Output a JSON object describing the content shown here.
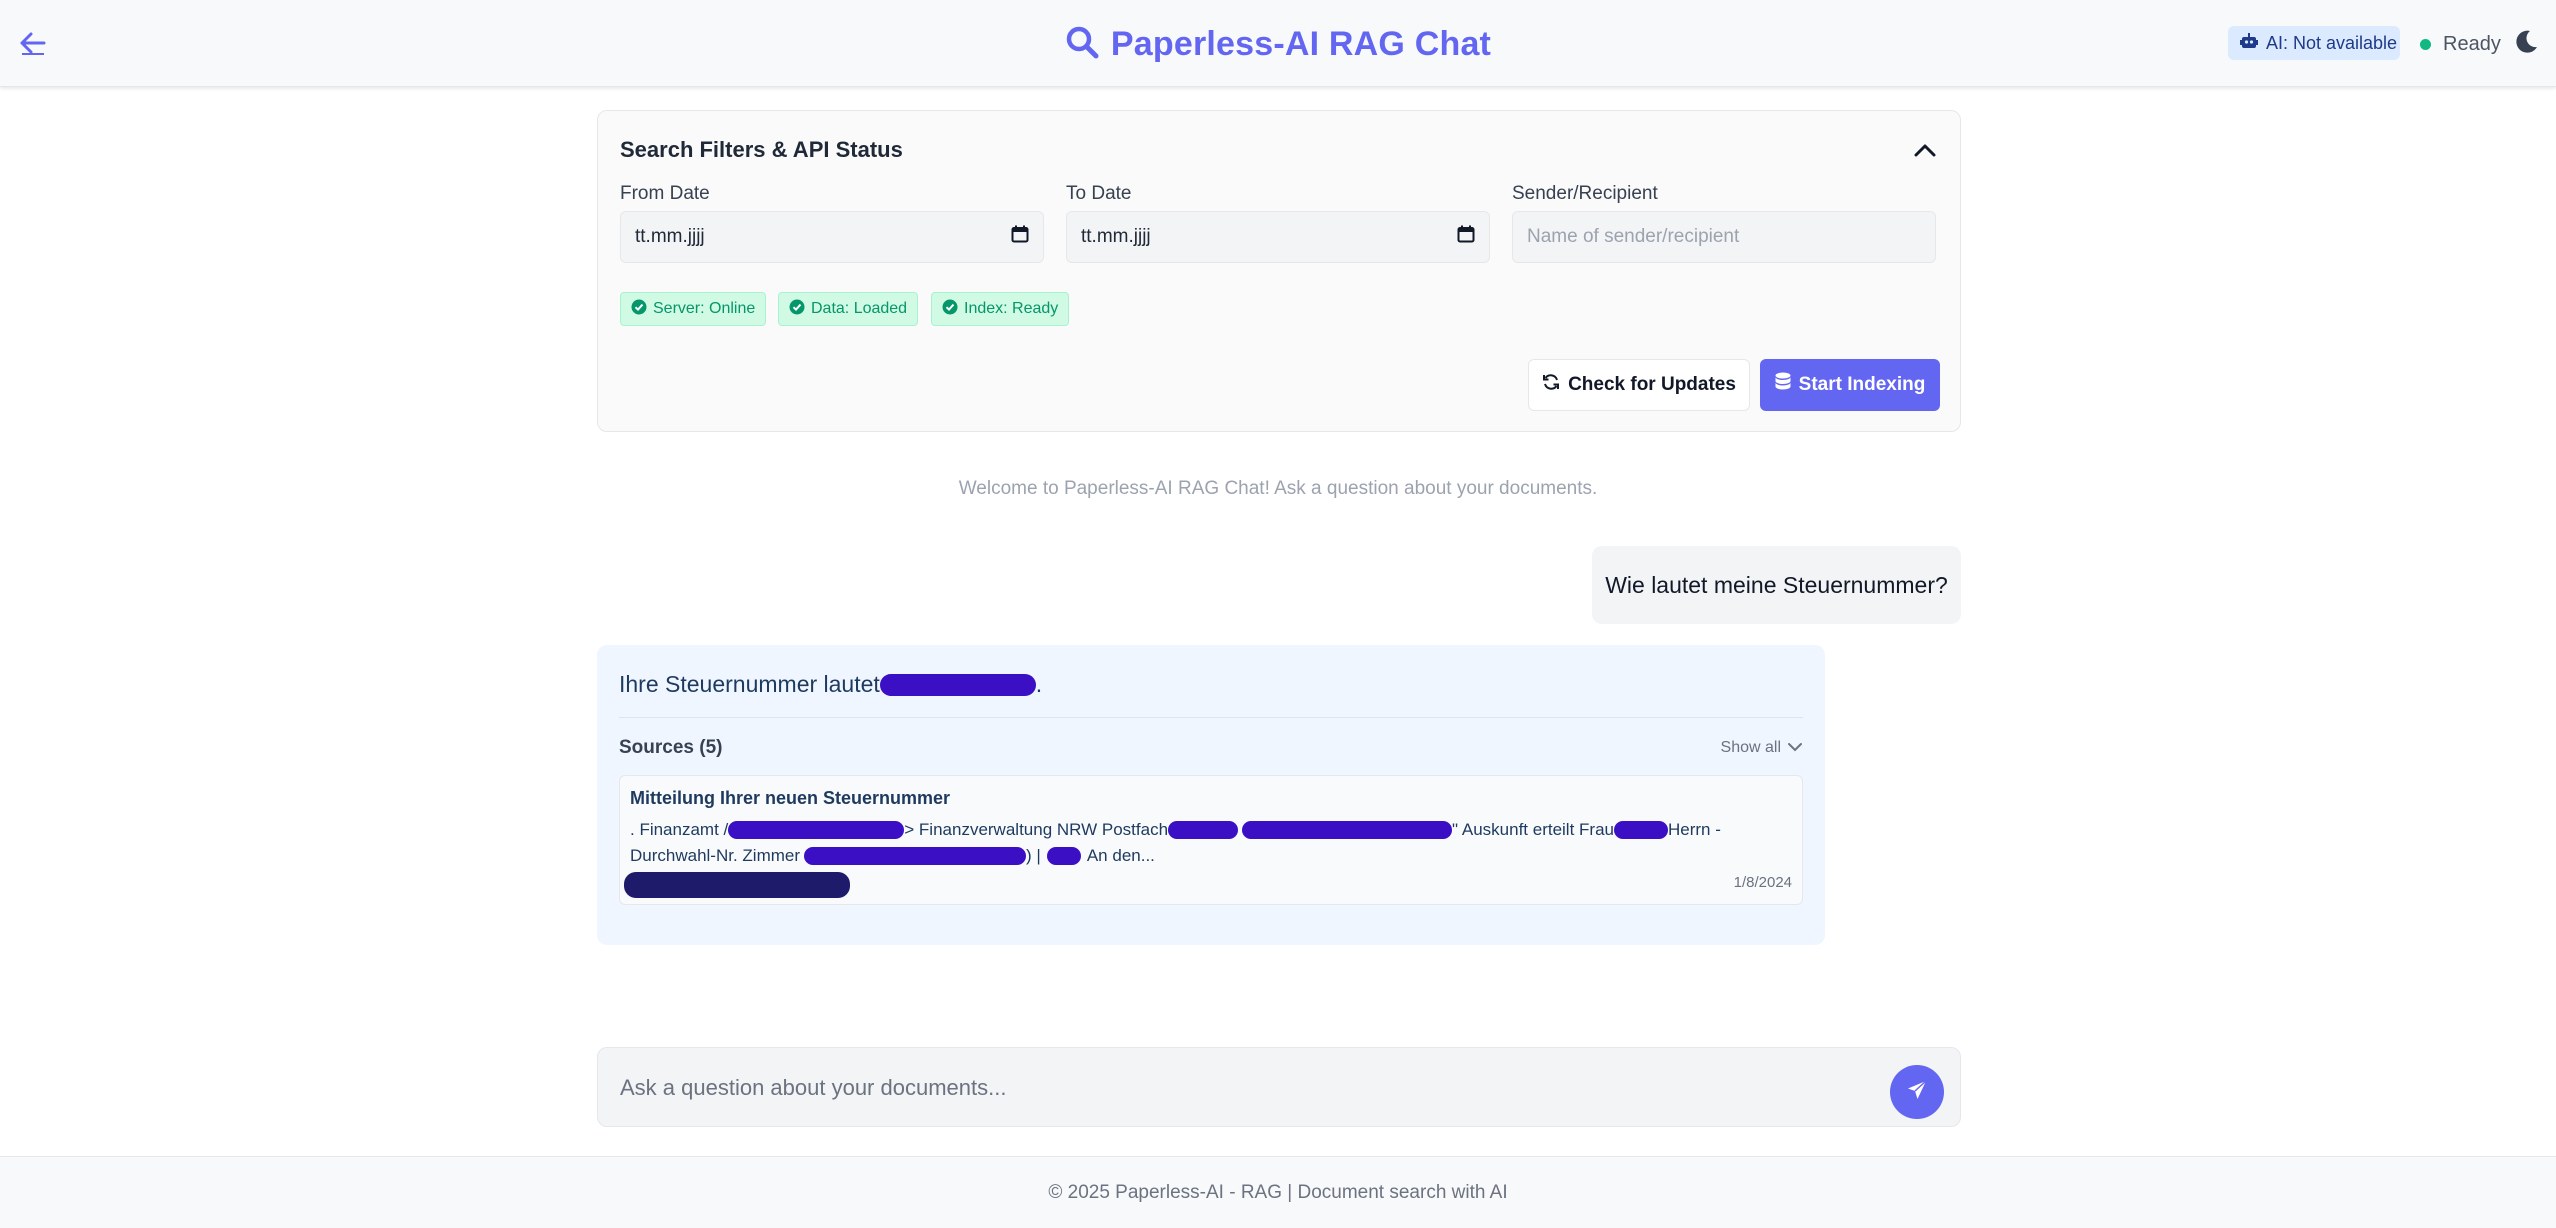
{
  "header": {
    "title": "Paperless-AI RAG Chat",
    "ai_badge": "AI: Not available",
    "status": "Ready"
  },
  "filters": {
    "title": "Search Filters & API Status",
    "from_label": "From Date",
    "from_value": "tt.mm.jjjj",
    "to_label": "To Date",
    "to_value": "tt.mm.jjjj",
    "sender_label": "Sender/Recipient",
    "sender_placeholder": "Name of sender/recipient",
    "status_pills": [
      "Server: Online",
      "Data: Loaded",
      "Index: Ready"
    ],
    "check_updates_label": "Check for Updates",
    "start_indexing_label": "Start Indexing"
  },
  "chat": {
    "welcome": "Welcome to Paperless-AI RAG Chat! Ask a question about your documents.",
    "user_message": "Wie lautet meine Steuernummer?",
    "answer_prefix": "Ihre Steuernummer lautet",
    "answer_suffix": ".",
    "sources_title": "Sources (5)",
    "show_all": "Show all",
    "source": {
      "title": "Mitteilung Ihrer neuen Steuernummer",
      "line1_a": ". Finanzamt /",
      "line1_b": "> Finanzverwaltung NRW Postfach",
      "line1_c": "\" Auskunft erteilt Frau",
      "line1_d": "Herrn -",
      "line2_a": "Durchwahl-Nr. Zimmer",
      "line2_b": ") |",
      "line2_c": "An den...",
      "date": "1/8/2024"
    }
  },
  "input": {
    "placeholder": "Ask a question about your documents..."
  },
  "footer": {
    "text": "© 2025 Paperless-AI - RAG | Document search with AI"
  },
  "colors": {
    "accent": "#6366f1",
    "success": "#10b981",
    "redaction": "#3b0fc4"
  }
}
